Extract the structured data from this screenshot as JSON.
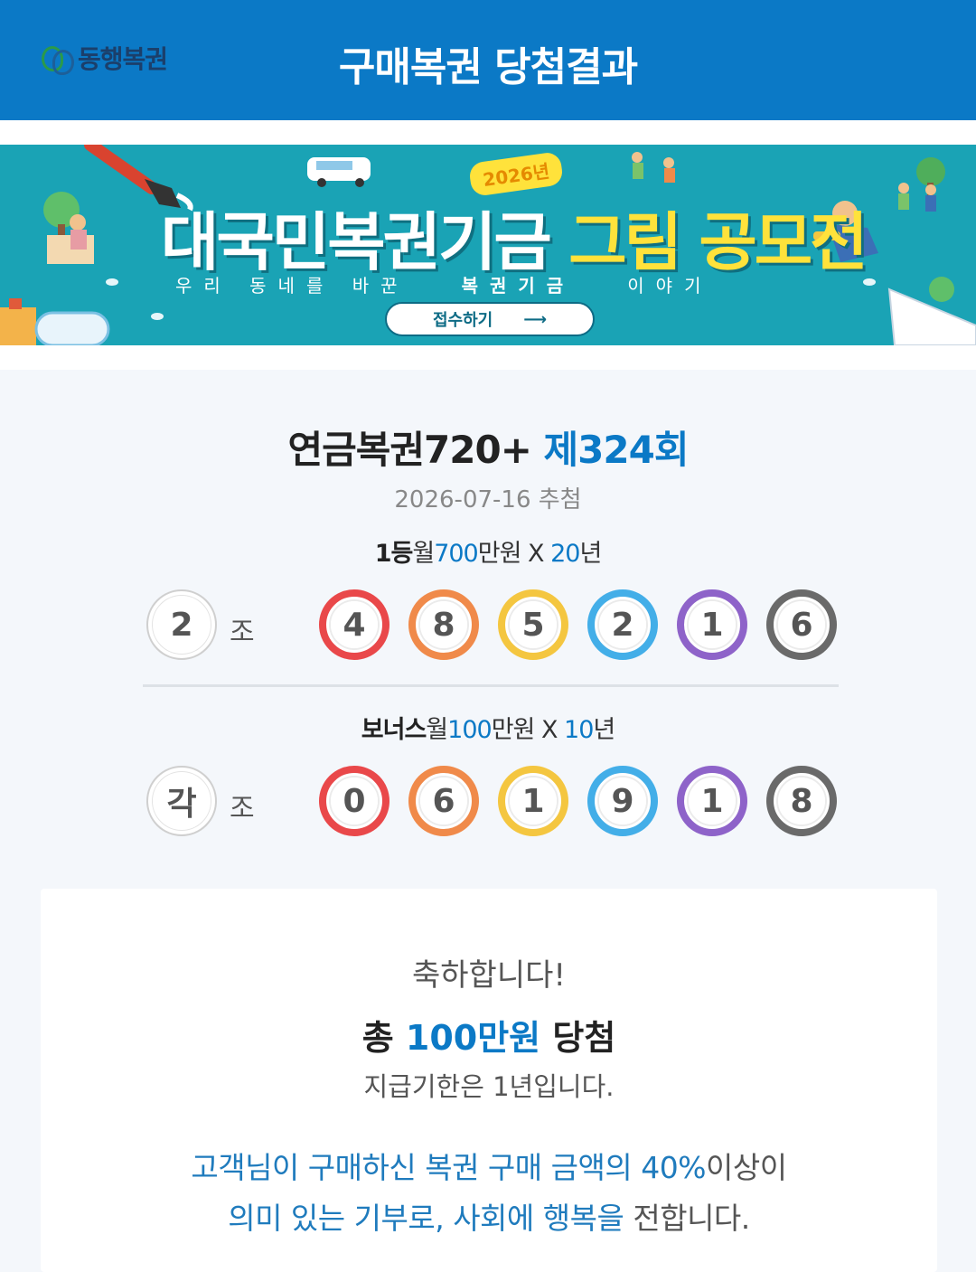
{
  "header": {
    "logo_text": "동행복권",
    "title": "구매복권 당첨결과"
  },
  "banner": {
    "year_badge": "2026년",
    "title_white": "대국민복권기금",
    "title_yellow": "그림 공모전",
    "subtitle_plain": "우리 동네를 바꾼",
    "subtitle_bold": "복권기금",
    "subtitle_end": "이야기",
    "button_label": "접수하기",
    "button_arrow": "⟶",
    "colors": {
      "background": "#1aa3b5",
      "accent": "#ffe23b"
    }
  },
  "draw": {
    "lottery_name": "연금복권720+",
    "round": "제324회",
    "date": "2026-07-16 추첨"
  },
  "first_prize": {
    "rank": "1등",
    "prefix": "월",
    "amount": "700",
    "unit": "만원 X ",
    "years": "20",
    "years_unit": "년",
    "group": "2",
    "group_suffix": "조",
    "numbers": [
      "4",
      "8",
      "5",
      "2",
      "1",
      "6"
    ]
  },
  "bonus_prize": {
    "rank": "보너스",
    "prefix": "월",
    "amount": "100",
    "unit": "만원 X ",
    "years": "10",
    "years_unit": "년",
    "group": "각",
    "group_suffix": "조",
    "numbers": [
      "0",
      "6",
      "1",
      "9",
      "1",
      "8"
    ]
  },
  "ball_colors": [
    "#e9484a",
    "#f08a4a",
    "#f4c640",
    "#43aee8",
    "#8e63c9",
    "#6a6a6a"
  ],
  "result": {
    "congrats": "축하합니다!",
    "total_prefix": "총 ",
    "total_amount": "100만원",
    "total_suffix": " 당첨",
    "deadline": "지급기한은 1년입니다.",
    "message_line1_blue": "고객님이 구매하신 복권 구매 금액의 40%",
    "message_line1_dark": "이상이",
    "message_line2_blue": "의미 있는 기부로, 사회에 행복을",
    "message_line2_dark": " 전합니다."
  }
}
